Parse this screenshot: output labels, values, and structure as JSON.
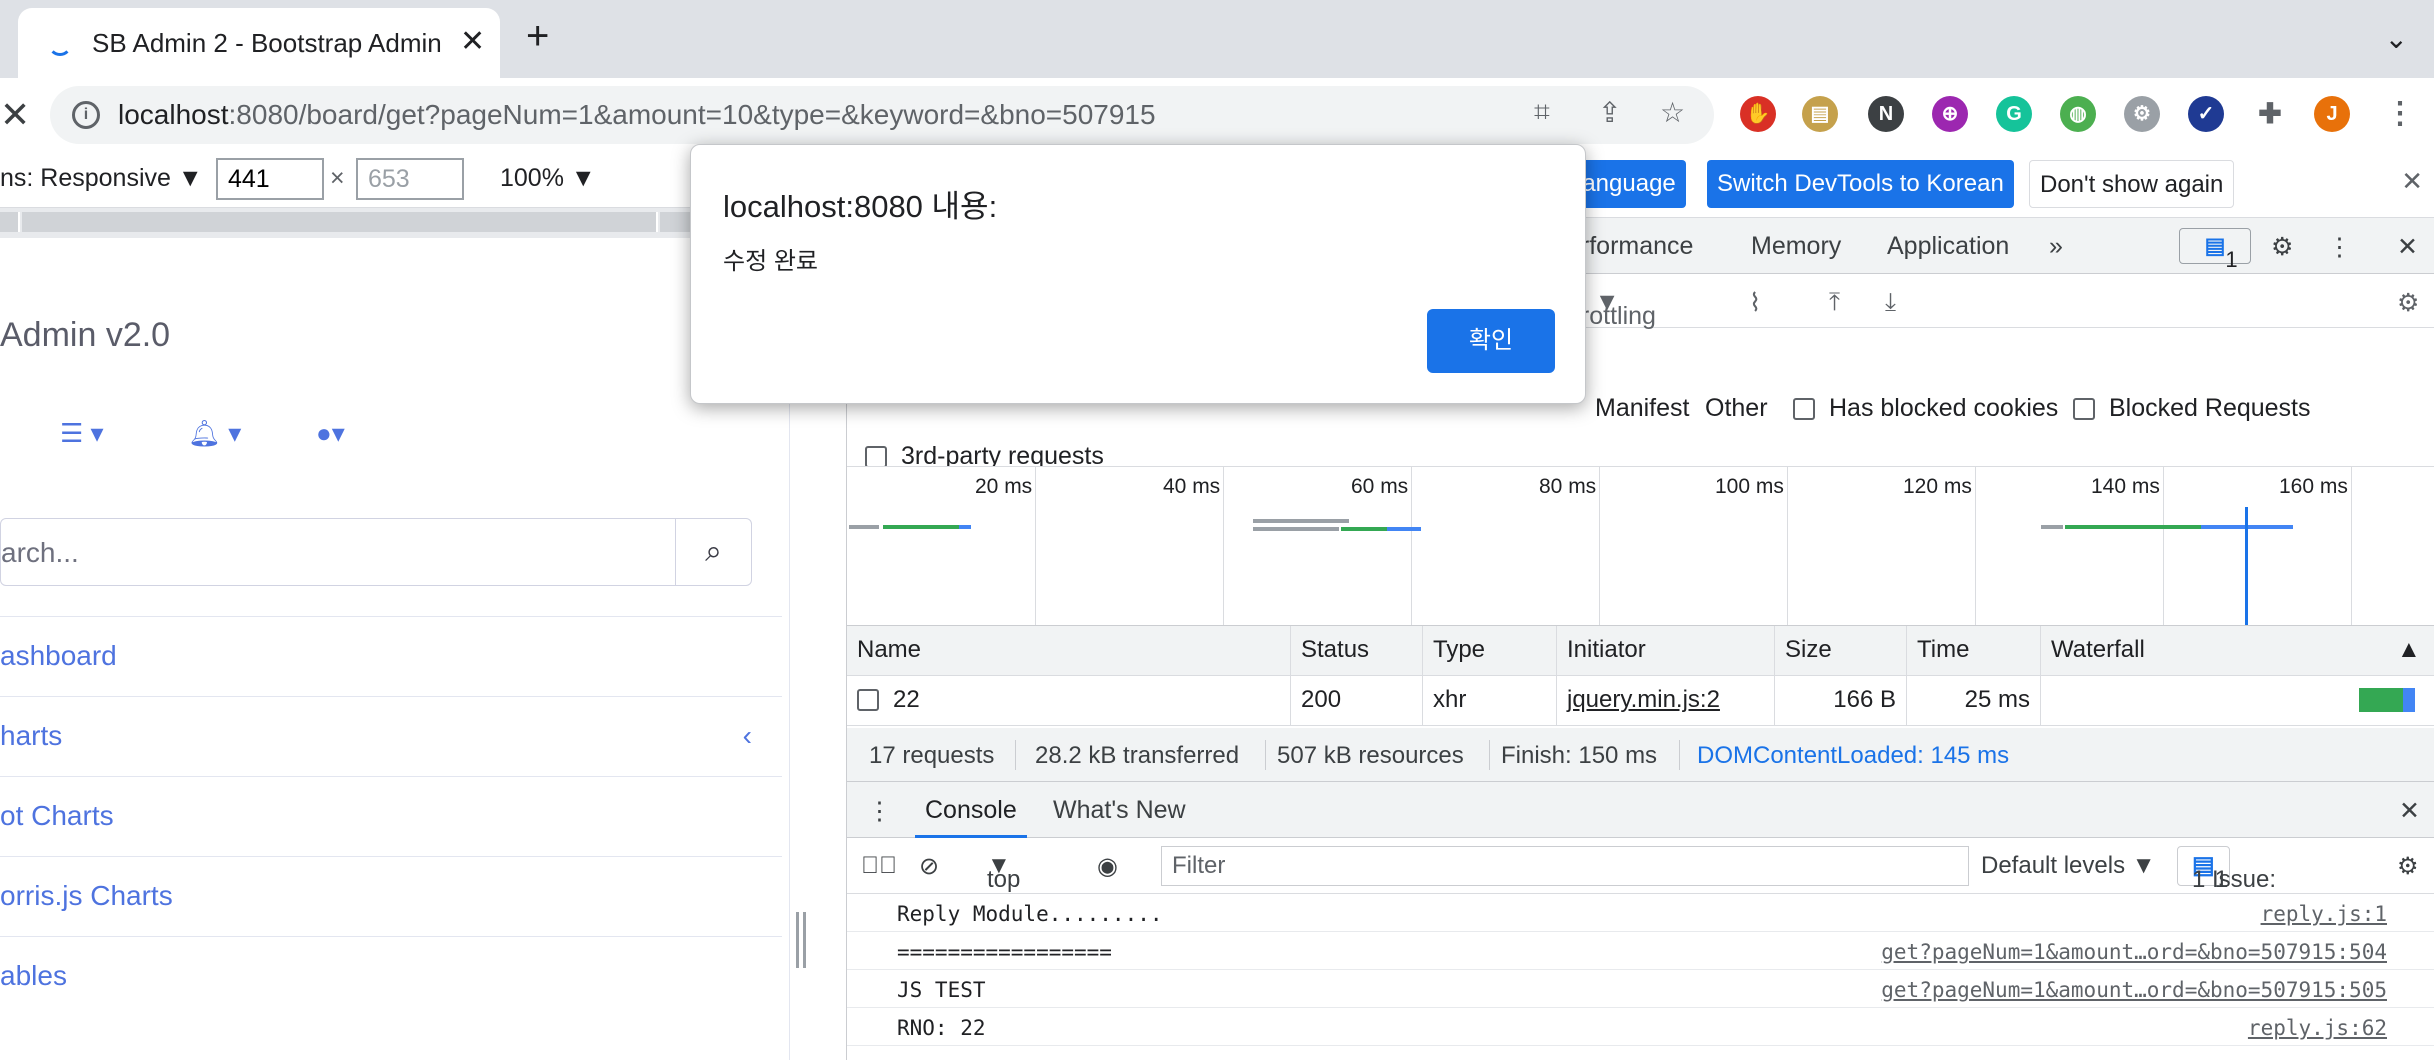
{
  "browser": {
    "tab_title": "SB Admin 2 - Bootstrap Admin",
    "url_host": "localhost",
    "url_rest": ":8080/board/get?pageNum=1&amount=10&type=&keyword=&bno=507915",
    "profile_initial": "J"
  },
  "device_toolbar": {
    "dimensions_label": "ns: Responsive ▼",
    "width": "441",
    "height": "653",
    "zoom": "100% ▼"
  },
  "page": {
    "brand": "Admin v2.0",
    "search_placeholder": "arch...",
    "nav_items": [
      "ashboard",
      "harts",
      "ot Charts",
      "orris.js Charts",
      "ables"
    ]
  },
  "devtools": {
    "infobar": {
      "lang_btn": "language",
      "switch_btn": "Switch DevTools to Korean",
      "dont_show_btn": "Don't show again"
    },
    "tabs": [
      "erformance",
      "Memory",
      "Application"
    ],
    "issue_count": "1",
    "throttling": "hrottling",
    "filters": {
      "manifest": "Manifest",
      "other": "Other",
      "blocked_cookies": "Has blocked cookies",
      "blocked_requests": "Blocked Requests",
      "third_party": "3rd-party requests"
    },
    "timeline_ticks": [
      "20 ms",
      "40 ms",
      "60 ms",
      "80 ms",
      "100 ms",
      "120 ms",
      "140 ms",
      "160 ms"
    ],
    "table": {
      "headers": [
        "Name",
        "Status",
        "Type",
        "Initiator",
        "Size",
        "Time",
        "Waterfall"
      ],
      "rows": [
        {
          "name": "22",
          "status": "200",
          "type": "xhr",
          "initiator": "jquery.min.js:2",
          "size": "166 B",
          "time": "25 ms"
        }
      ]
    },
    "summary": {
      "requests": "17 requests",
      "transferred": "28.2 kB transferred",
      "resources": "507 kB resources",
      "finish": "Finish: 150 ms",
      "dcl": "DOMContentLoaded: 145 ms"
    },
    "drawer": {
      "console_tab": "Console",
      "whats_new_tab": "What's New",
      "context": "top",
      "filter_placeholder": "Filter",
      "levels": "Default levels ▼",
      "issues_label": "1 Issue:",
      "issues_count": "1"
    },
    "console_lines": [
      {
        "msg": "Reply Module.........",
        "src": "reply.js:1"
      },
      {
        "msg": "=================",
        "src": "get?pageNum=1&amount…ord=&bno=507915:504"
      },
      {
        "msg": "JS TEST",
        "src": "get?pageNum=1&amount…ord=&bno=507915:505"
      },
      {
        "msg": "RNO: 22",
        "src": "reply.js:62"
      }
    ]
  },
  "dialog": {
    "title": "localhost:8080 내용:",
    "message": "수정 완료",
    "ok_label": "확인"
  },
  "colors": {
    "accent": "#1a73e8",
    "page_link": "#4e73df"
  }
}
